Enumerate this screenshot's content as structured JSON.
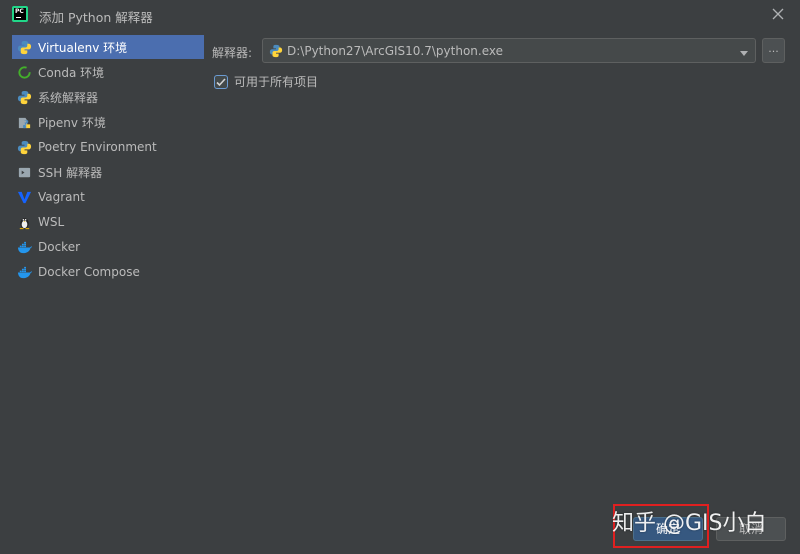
{
  "window": {
    "title": "添加 Python 解释器",
    "app_icon_text": "PC"
  },
  "sidebar": {
    "items": [
      {
        "label": "Virtualenv 环境",
        "icon": "python-icon",
        "selected": true
      },
      {
        "label": "Conda 环境",
        "icon": "conda-icon",
        "selected": false
      },
      {
        "label": "系统解释器",
        "icon": "python-icon",
        "selected": false
      },
      {
        "label": "Pipenv 环境",
        "icon": "pipenv-icon",
        "selected": false
      },
      {
        "label": "Poetry Environment",
        "icon": "python-icon",
        "selected": false
      },
      {
        "label": "SSH 解释器",
        "icon": "ssh-terminal-icon",
        "selected": false
      },
      {
        "label": "Vagrant",
        "icon": "vagrant-icon",
        "selected": false
      },
      {
        "label": "WSL",
        "icon": "linux-penguin-icon",
        "selected": false
      },
      {
        "label": "Docker",
        "icon": "docker-icon",
        "selected": false
      },
      {
        "label": "Docker Compose",
        "icon": "docker-icon",
        "selected": false
      }
    ]
  },
  "main": {
    "interpreter_label": "解释器:",
    "interpreter_value": "D:\\Python27\\ArcGIS10.7\\python.exe",
    "browse_label": "...",
    "make_available_label": "可用于所有项目",
    "make_available_checked": true
  },
  "footer": {
    "ok_label": "确定",
    "cancel_label": "取消"
  },
  "overlay": {
    "watermark_text": "知乎 @GIS小白",
    "highlight_color": "#e02020"
  },
  "colors": {
    "background": "#3c3f41",
    "selection": "#4b6eaf",
    "primary_button": "#365880"
  }
}
